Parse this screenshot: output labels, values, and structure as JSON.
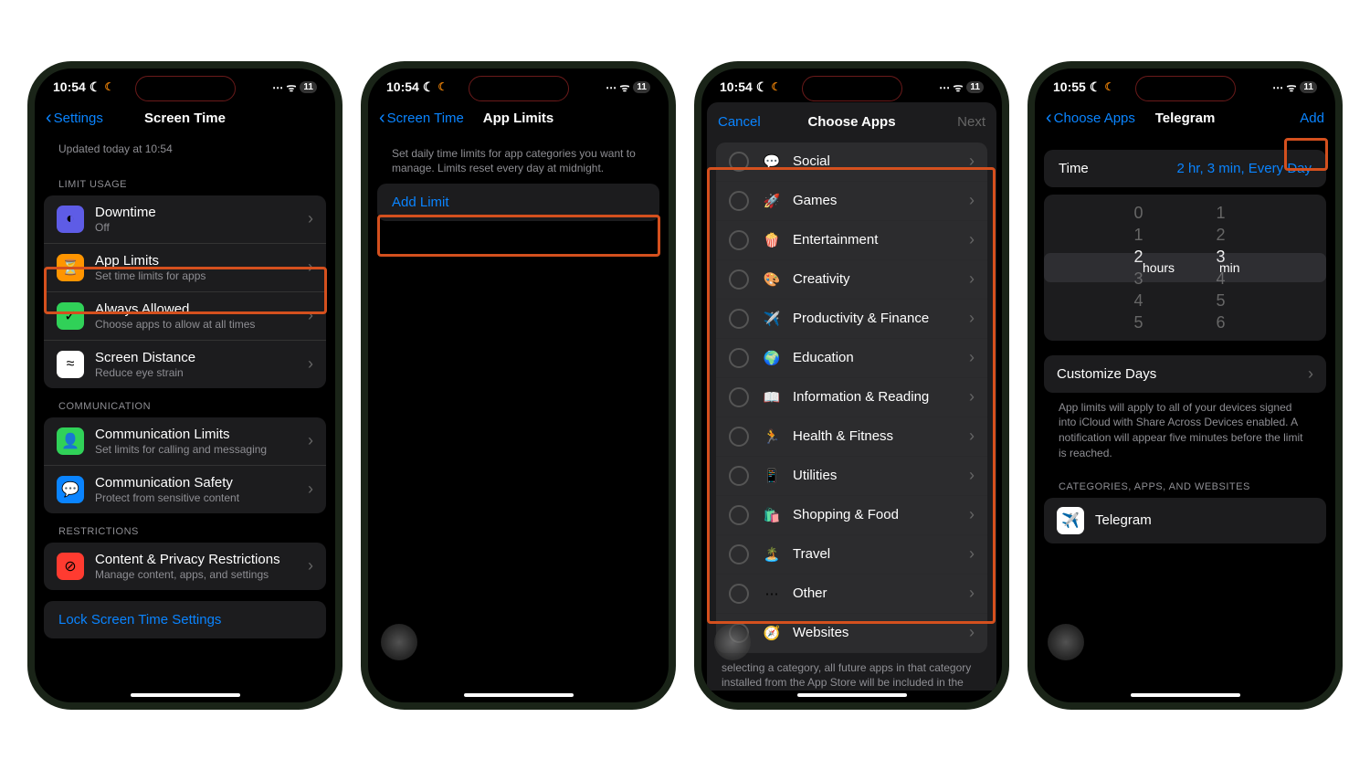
{
  "status": {
    "time1": "10:54",
    "time4": "10:55",
    "battery": "11"
  },
  "phone1": {
    "back": "Settings",
    "title": "Screen Time",
    "updated": "Updated today at 10:54",
    "section_limit": "LIMIT USAGE",
    "downtime": {
      "title": "Downtime",
      "sub": "Off"
    },
    "app_limits": {
      "title": "App Limits",
      "sub": "Set time limits for apps"
    },
    "always_allowed": {
      "title": "Always Allowed",
      "sub": "Choose apps to allow at all times"
    },
    "screen_distance": {
      "title": "Screen Distance",
      "sub": "Reduce eye strain"
    },
    "section_comm": "COMMUNICATION",
    "comm_limits": {
      "title": "Communication Limits",
      "sub": "Set limits for calling and messaging"
    },
    "comm_safety": {
      "title": "Communication Safety",
      "sub": "Protect from sensitive content"
    },
    "section_restrict": "RESTRICTIONS",
    "content_privacy": {
      "title": "Content & Privacy Restrictions",
      "sub": "Manage content, apps, and settings"
    },
    "lock_settings": "Lock Screen Time Settings"
  },
  "phone2": {
    "back": "Screen Time",
    "title": "App Limits",
    "description": "Set daily time limits for app categories you want to manage. Limits reset every day at midnight.",
    "add_limit": "Add Limit"
  },
  "phone3": {
    "cancel": "Cancel",
    "title": "Choose Apps",
    "next": "Next",
    "categories": [
      {
        "emoji": "💬",
        "name": "Social"
      },
      {
        "emoji": "🚀",
        "name": "Games"
      },
      {
        "emoji": "🍿",
        "name": "Entertainment"
      },
      {
        "emoji": "🎨",
        "name": "Creativity"
      },
      {
        "emoji": "✈️",
        "name": "Productivity & Finance"
      },
      {
        "emoji": "🌍",
        "name": "Education"
      },
      {
        "emoji": "📖",
        "name": "Information & Reading"
      },
      {
        "emoji": "🏃",
        "name": "Health & Fitness"
      },
      {
        "emoji": "📱",
        "name": "Utilities"
      },
      {
        "emoji": "🛍️",
        "name": "Shopping & Food"
      },
      {
        "emoji": "🏝️",
        "name": "Travel"
      },
      {
        "emoji": "⋯",
        "name": "Other"
      },
      {
        "emoji": "🧭",
        "name": "Websites"
      }
    ],
    "footer": "selecting a category, all future apps in that category installed from the App Store will be included in the limit."
  },
  "phone4": {
    "back": "Choose Apps",
    "title": "Telegram",
    "add": "Add",
    "time_label": "Time",
    "time_value": "2 hr, 3 min, Every Day",
    "picker_hours": [
      "0",
      "1",
      "2",
      "3",
      "4",
      "5"
    ],
    "picker_mins": [
      "1",
      "2",
      "3",
      "4",
      "5",
      "6"
    ],
    "hours_unit": "hours",
    "min_unit": "min",
    "customize": "Customize Days",
    "note": "App limits will apply to all of your devices signed into iCloud with Share Across Devices enabled. A notification will appear five minutes before the limit is reached.",
    "section_cat": "CATEGORIES, APPS, AND WEBSITES",
    "app_name": "Telegram"
  }
}
